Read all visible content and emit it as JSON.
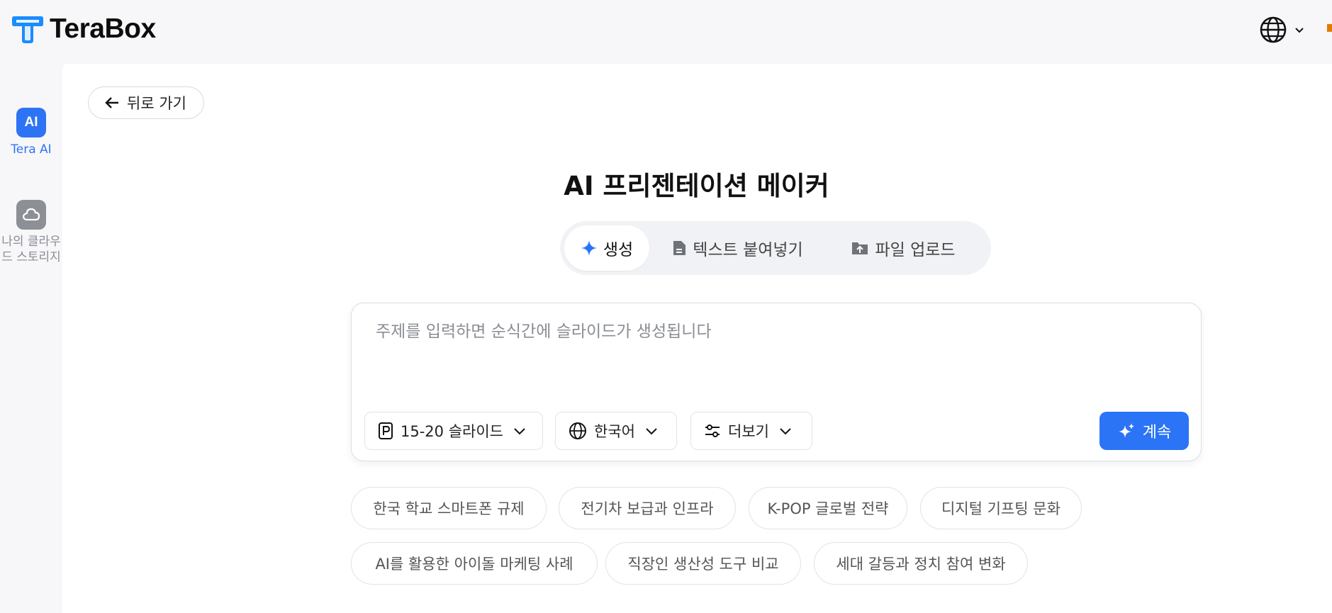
{
  "header": {
    "brand": "TeraBox",
    "language_menu_icon": "globe-icon"
  },
  "sidebar": {
    "items": [
      {
        "label": "Tera AI",
        "icon": "ai-icon",
        "active": true
      },
      {
        "label": "나의 클라우드 스토리지",
        "icon": "cloud-icon",
        "active": false
      }
    ]
  },
  "main": {
    "back_label": "뒤로 가기",
    "title": "AI 프리젠테이션 메이커",
    "tabs": [
      {
        "label": "생성",
        "icon": "sparkle-icon",
        "active": true
      },
      {
        "label": "텍스트 붙여넣기",
        "icon": "document-icon",
        "active": false
      },
      {
        "label": "파일 업로드",
        "icon": "folder-upload-icon",
        "active": false
      }
    ],
    "prompt": {
      "placeholder": "주제를 입력하면 순식간에 슬라이드가 생성됩니다",
      "value": ""
    },
    "options": {
      "slides": "15-20 슬라이드",
      "language": "한국어",
      "more": "더보기"
    },
    "continue_label": "계속",
    "suggestions": [
      "한국 학교 스마트폰 규제",
      "전기차 보급과 인프라",
      "K-POP 글로벌 전략",
      "디지털 기프팅 문화",
      "AI를 활용한 아이돌 마케팅 사례",
      "직장인 생산성 도구 비교",
      "세대 갈등과 정치 참여 변화"
    ]
  },
  "colors": {
    "accent": "#2b74f6",
    "background": "#f7f7f9",
    "panel": "#ffffff"
  }
}
